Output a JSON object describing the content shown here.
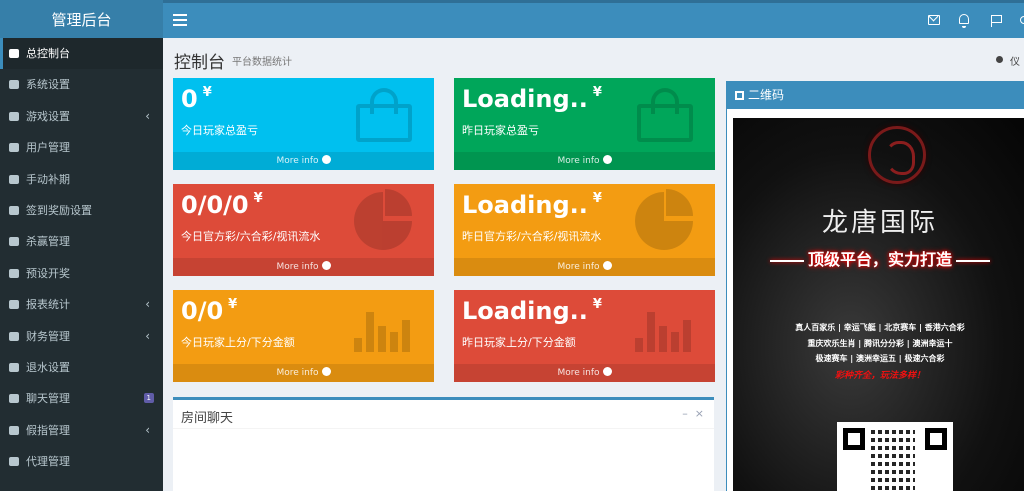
{
  "app": {
    "title": "管理后台"
  },
  "topbar": {
    "icons": [
      "bars-icon",
      "envelope-icon",
      "bell-icon",
      "flag-icon",
      "user-icon"
    ]
  },
  "sidebar": {
    "items": [
      {
        "label": "总控制台",
        "icon": "dashboard-icon",
        "active": true
      },
      {
        "label": "系统设置",
        "icon": "cogs-icon"
      },
      {
        "label": "游戏设置",
        "icon": "gamepad-icon",
        "chevron": "‹"
      },
      {
        "label": "用户管理",
        "icon": "users-icon"
      },
      {
        "label": "手动补期",
        "icon": "gear-icon"
      },
      {
        "label": "签到奖励设置",
        "icon": "gear-icon"
      },
      {
        "label": "杀赢管理",
        "icon": "cubes-icon"
      },
      {
        "label": "预设开奖",
        "icon": "cubes-icon"
      },
      {
        "label": "报表统计",
        "icon": "list-icon",
        "chevron": "‹"
      },
      {
        "label": "财务管理",
        "icon": "database-icon",
        "chevron": "‹"
      },
      {
        "label": "退水设置",
        "icon": "cloud-icon"
      },
      {
        "label": "聊天管理",
        "icon": "comments-icon",
        "badge": "1"
      },
      {
        "label": "假指管理",
        "icon": "comment-icon",
        "chevron": "‹"
      },
      {
        "label": "代理管理",
        "icon": "user-plus-icon"
      }
    ]
  },
  "header": {
    "title": "控制台",
    "subtitle": "平台数据统计",
    "breadcrumb": "仪"
  },
  "boxes": [
    {
      "value": "0",
      "unit": "¥",
      "label": "今日玩家总盈亏",
      "more": "More info",
      "color": "#00c0ef",
      "icon": "shopping-bag-icon"
    },
    {
      "value": "Loading..",
      "unit": "¥",
      "label": "昨日玩家总盈亏",
      "more": "More info",
      "color": "#00a65a",
      "icon": "shopping-bag-icon"
    },
    {
      "value": "0/0/0",
      "unit": "¥",
      "label": "今日官方彩/六合彩/视讯流水",
      "more": "More info",
      "color": "#dd4b39",
      "icon": "pie-chart-icon"
    },
    {
      "value": "Loading..",
      "unit": "¥",
      "label": "昨日官方彩/六合彩/视讯流水",
      "more": "More info",
      "color": "#f39c12",
      "icon": "pie-chart-icon"
    },
    {
      "value": "0/0",
      "unit": "¥",
      "label": "今日玩家上分/下分金额",
      "more": "More info",
      "color": "#f39c12",
      "icon": "bar-chart-icon"
    },
    {
      "value": "Loading..",
      "unit": "¥",
      "label": "昨日玩家上分/下分金额",
      "more": "More info",
      "color": "#dd4b39",
      "icon": "bar-chart-icon"
    }
  ],
  "chat": {
    "title": "房间聊天",
    "tools": [
      "minimize-icon",
      "close-icon"
    ]
  },
  "qrpanel": {
    "title": "二维码",
    "poster": {
      "brand": "龙唐国际",
      "slogan": "顶级平台，实力打造",
      "line1": "真人百家乐 | 幸运飞艇 | 北京赛车 | 香港六合彩",
      "line2": "重庆欢乐生肖 | 腾讯分分彩 | 澳洲幸运十",
      "line3": "极速赛车 | 澳洲幸运五 | 极速六合彩",
      "tagline": "彩种齐全，玩法多样！"
    }
  }
}
